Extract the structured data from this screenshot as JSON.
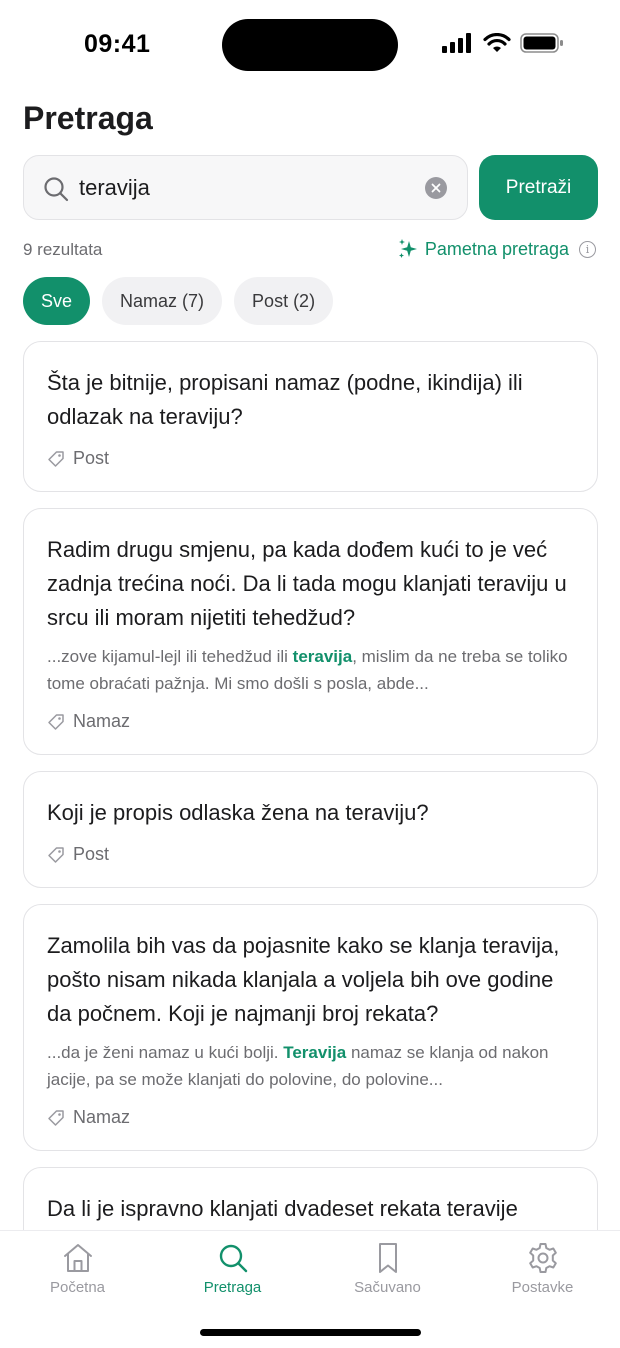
{
  "status": {
    "time": "09:41"
  },
  "header": {
    "title": "Pretraga"
  },
  "search": {
    "value": "teravija",
    "button_label": "Pretraži"
  },
  "meta": {
    "results_count": "9 rezultata",
    "smart_search_label": "Pametna pretraga"
  },
  "filters": [
    {
      "label": "Sve",
      "active": true
    },
    {
      "label": "Namaz (7)",
      "active": false
    },
    {
      "label": "Post (2)",
      "active": false
    }
  ],
  "results": [
    {
      "title": "Šta je bitnije, propisani namaz (podne, ikindija) ili odlazak na teraviju?",
      "tag": "Post"
    },
    {
      "title": "Radim drugu smjenu, pa kada dođem kući to je već zadnja trećina noći. Da li tada mogu klanjati teraviju u srcu ili moram nijetiti tehedžud?",
      "snippet_before": "...zove kijamul-lejl ili tehedžud ili ",
      "snippet_highlight": "teravija",
      "snippet_after": ", mislim da ne treba se toliko tome obraćati pažnja. Mi smo došli s posla, abde...",
      "tag": "Namaz"
    },
    {
      "title": "Koji je propis odlaska žena na teraviju?",
      "tag": "Post"
    },
    {
      "title": "Zamolila bih vas da pojasnite kako se klanja teravija, pošto nisam nikada klanjala a voljela bih ove godine da počnem. Koji je najmanji broj rekata?",
      "snippet_before": "...da je ženi namaz u kući bolji. ",
      "snippet_highlight": "Teravija",
      "snippet_after": " namaz se klanja od nakon jacije, pa se može klanjati do polovine, do polovine...",
      "tag": "Namaz"
    },
    {
      "title": "Da li je ispravno klanjati dvadeset rekata teravije",
      "tag": ""
    }
  ],
  "tabs": [
    {
      "label": "Početna",
      "icon": "home-icon",
      "active": false
    },
    {
      "label": "Pretraga",
      "icon": "search-icon",
      "active": true
    },
    {
      "label": "Sačuvano",
      "icon": "bookmark-icon",
      "active": false
    },
    {
      "label": "Postavke",
      "icon": "gear-icon",
      "active": false
    }
  ],
  "colors": {
    "accent": "#12906b",
    "muted": "#6c6c70"
  }
}
